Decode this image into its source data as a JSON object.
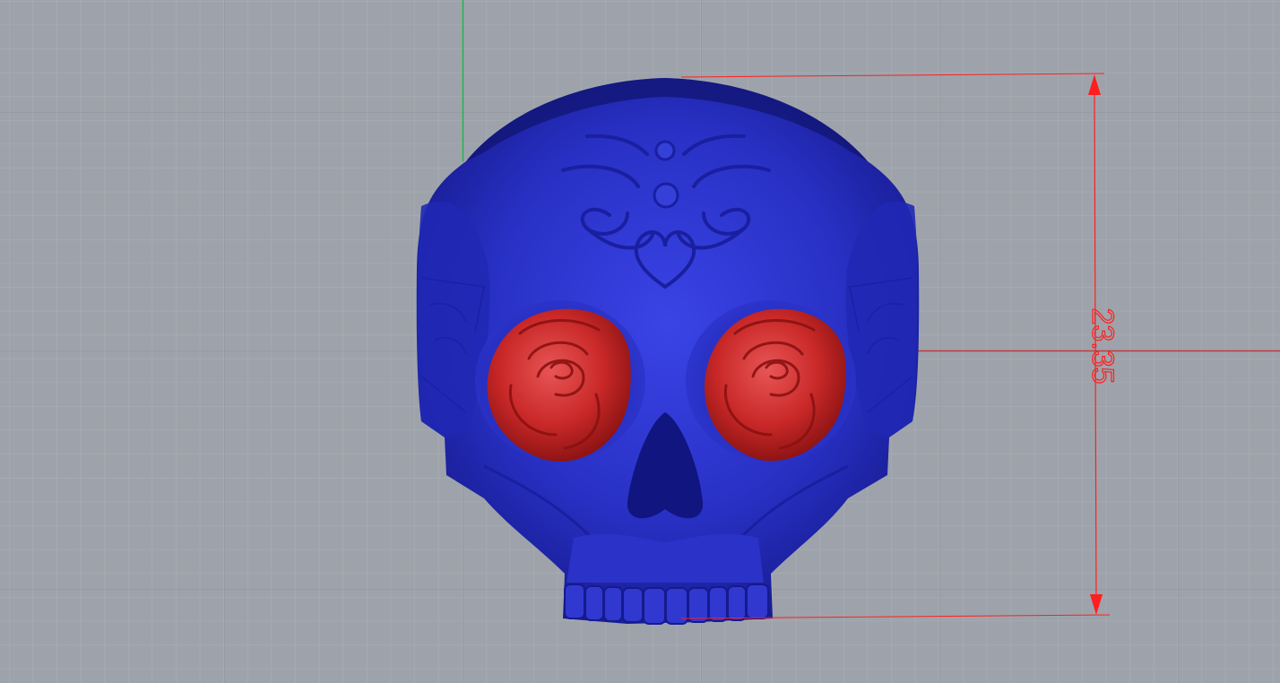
{
  "viewport": {
    "background_color": "#9ea3ab",
    "grid_minor_color": "#a9aeb5",
    "grid_major_color": "#8f949c",
    "axis_y_color": "#22b14c",
    "axis_x_color": "#c23a3a"
  },
  "model": {
    "skull_color": "#2a32c8",
    "rose_color": "#cc2f2f"
  },
  "dimension": {
    "label": "23.35",
    "color": "#ff1f1f"
  }
}
